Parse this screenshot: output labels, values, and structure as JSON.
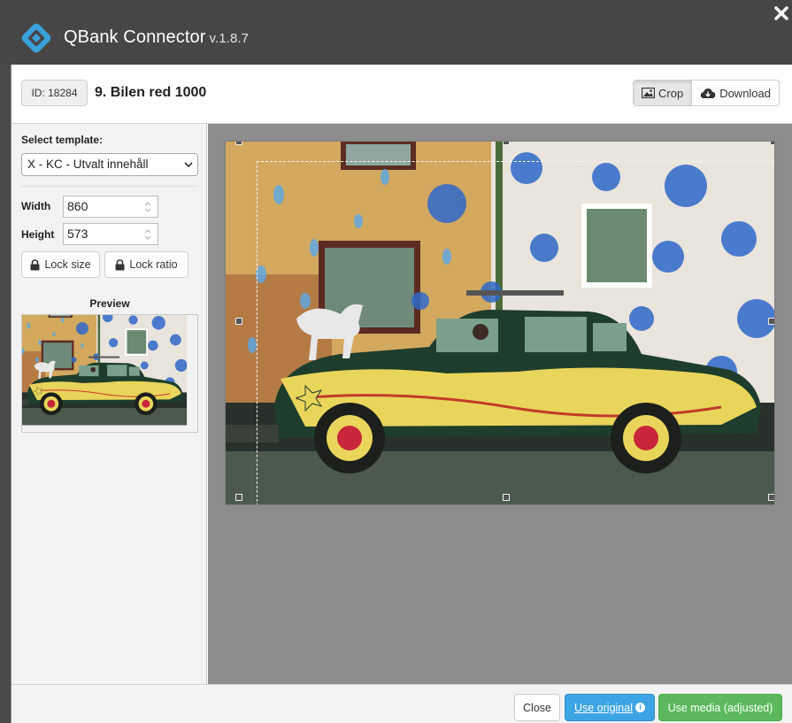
{
  "app": {
    "name": "QBank Connector",
    "version": "v.1.8.7"
  },
  "media": {
    "id_label": "ID: 18284",
    "title": "9. Bilen red 1000"
  },
  "toolbar": {
    "crop_label": "Crop",
    "download_label": "Download"
  },
  "sidebar": {
    "template_label": "Select template:",
    "template_selected": "X - KC - Utvalt innehåll",
    "width_label": "Width",
    "width_value": "860",
    "height_label": "Height",
    "height_value": "573",
    "lock_size_label": "Lock size",
    "lock_ratio_label": "Lock ratio",
    "preview_label": "Preview"
  },
  "footer": {
    "close_label": "Close",
    "use_original_label": "Use original",
    "use_media_label": "Use media (adjusted)"
  },
  "colors": {
    "titlebar": "#464646",
    "logo": "#3aa0dc",
    "primary_blue": "#3da5e3",
    "success_green": "#5cb85c",
    "canvas_bg": "#8d8d8d"
  },
  "icons": {
    "logo": "qbank-logo-icon",
    "close": "close-icon",
    "crop": "image-icon",
    "download": "cloud-download-icon",
    "lock": "lock-icon",
    "info": "info-icon"
  }
}
